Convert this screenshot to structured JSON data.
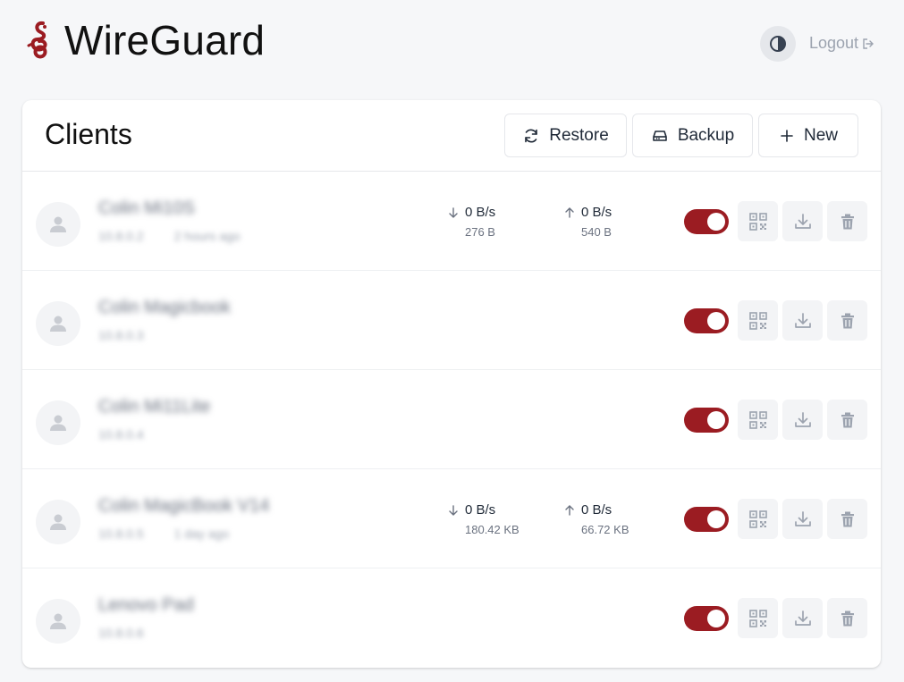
{
  "app": {
    "title": "WireGuard",
    "logout_label": "Logout"
  },
  "clients_card": {
    "heading": "Clients",
    "buttons": {
      "restore": "Restore",
      "backup": "Backup",
      "new": "New"
    }
  },
  "colors": {
    "accent": "#9b1c22",
    "muted_icon": "#9ca3af",
    "page_bg": "#f6f7f9"
  },
  "clients": [
    {
      "name": "Colin Mi10S",
      "ip": "10.8.0.2",
      "ago": "2 hours ago",
      "enabled": true,
      "down_rate": "0 B/s",
      "down_total": "276 B",
      "up_rate": "0 B/s",
      "up_total": "540 B"
    },
    {
      "name": "Colin Magicbook",
      "ip": "10.8.0.3",
      "ago": "",
      "enabled": true,
      "down_rate": "",
      "down_total": "",
      "up_rate": "",
      "up_total": ""
    },
    {
      "name": "Colin Mi11Lite",
      "ip": "10.8.0.4",
      "ago": "",
      "enabled": true,
      "down_rate": "",
      "down_total": "",
      "up_rate": "",
      "up_total": ""
    },
    {
      "name": "Colin MagicBook V14",
      "ip": "10.8.0.5",
      "ago": "1 day ago",
      "enabled": true,
      "down_rate": "0 B/s",
      "down_total": "180.42 KB",
      "up_rate": "0 B/s",
      "up_total": "66.72 KB"
    },
    {
      "name": "Lenovo Pad",
      "ip": "10.8.0.6",
      "ago": "",
      "enabled": true,
      "down_rate": "",
      "down_total": "",
      "up_rate": "",
      "up_total": ""
    }
  ]
}
